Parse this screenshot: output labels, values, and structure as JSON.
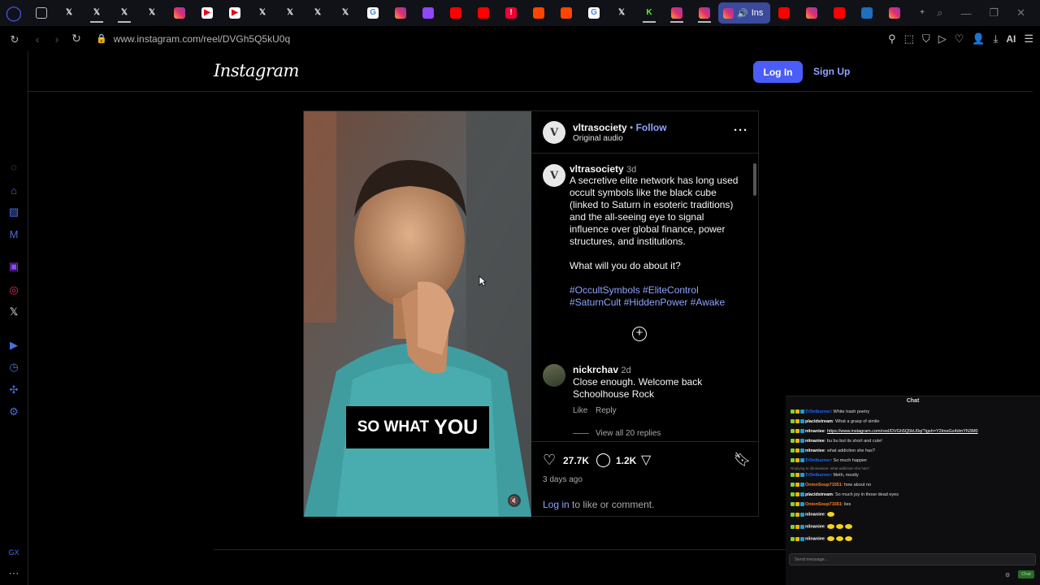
{
  "browser": {
    "url": "www.instagram.com/reel/DVGh5Q5kU0q",
    "active_tab_label": "Ins",
    "ai_label": "AI",
    "sidebar_bottom_label": "GX",
    "tabs": [
      "mail",
      "x",
      "x",
      "x",
      "x",
      "instagram",
      "netflix",
      "netflix",
      "x",
      "x",
      "x",
      "x",
      "google",
      "instagram",
      "twitch",
      "youtube",
      "youtube",
      "alert",
      "reddit",
      "reddit",
      "google",
      "x",
      "kick",
      "instagram",
      "instagram"
    ],
    "tabs_after_active": [
      "youtube",
      "instagram",
      "youtube",
      "blue-app",
      "instagram",
      "new-tab-plus"
    ]
  },
  "instagram": {
    "logo": "Instagram",
    "login_button": "Log In",
    "signup_link": "Sign Up",
    "post": {
      "author": "vltrasociety",
      "follow_separator": "•",
      "follow_label": "Follow",
      "audio": "Original audio",
      "avatar_letter": "V",
      "video_caption_word1": "SO WHAT",
      "video_caption_word2": "YOU",
      "caption_user": "vltrasociety",
      "caption_age": "3d",
      "caption_text": "A secretive elite network has long used occult symbols like the black cube (linked to Saturn in esoteric traditions) and the all-seeing eye to signal influence over global finance, power structures, and institutions.",
      "caption_question": "What will you do about it?",
      "hashtags": "#OccultSymbols #EliteControl #SaturnCult #HiddenPower #Awake",
      "comment": {
        "user": "nickrchav",
        "age": "2d",
        "text": "Close enough. Welcome back Schoolhouse Rock",
        "like_label": "Like",
        "reply_label": "Reply",
        "view_replies": "View all 20 replies"
      },
      "likes": "27.7K",
      "comments_count": "1.2K",
      "date": "3 days ago",
      "login_link": "Log in",
      "login_prompt_rest": " to like or comment."
    }
  },
  "chat": {
    "title": "Chat",
    "input_placeholder": "Send message...",
    "send_label": "Chat",
    "lines": [
      {
        "user": "TrDetburner",
        "sep": ": ",
        "msg": "White trash poetry"
      },
      {
        "user": "placidstream",
        "sep": ": ",
        "msg": "What a grasp of simile"
      },
      {
        "user": "niinaniee",
        "sep": ": ",
        "msg": "https://www.instagram.com/reel/DVGh5Q5kU0q/?igsh=Y2lmeGs4dmYN3M0"
      },
      {
        "user": "niinaniee",
        "sep": ": ",
        "msg": "bu bu but its short and cute!"
      },
      {
        "user": "niinaniee",
        "sep": ": ",
        "msg": "what addiction she has?"
      },
      {
        "user": "TrDetburner",
        "sep": ": ",
        "msg": "So much happier"
      },
      {
        "note": "Replying to @niinaniee: what addiction she has?"
      },
      {
        "user": "TrDetburner",
        "sep": ": ",
        "msg": "Meth, mostly"
      },
      {
        "user": "OnionSoup71551",
        "sep": ": ",
        "msg": "how about no"
      },
      {
        "user": "placidstream",
        "sep": ": ",
        "msg": "So much joy in those dead eyes"
      },
      {
        "user": "OnionSoup71551",
        "sep": ": ",
        "msg": "lies"
      },
      {
        "user": "niinaniee",
        "sep": ": ",
        "msg": ""
      },
      {
        "user": "niinaniee",
        "sep": ": ",
        "msg": ""
      },
      {
        "user": "niinaniee",
        "sep": ": ",
        "msg": ""
      }
    ]
  },
  "colors": {
    "accent": "#4a5df9",
    "link": "#8ea4ff",
    "active_tab": "#3b4a9c"
  }
}
